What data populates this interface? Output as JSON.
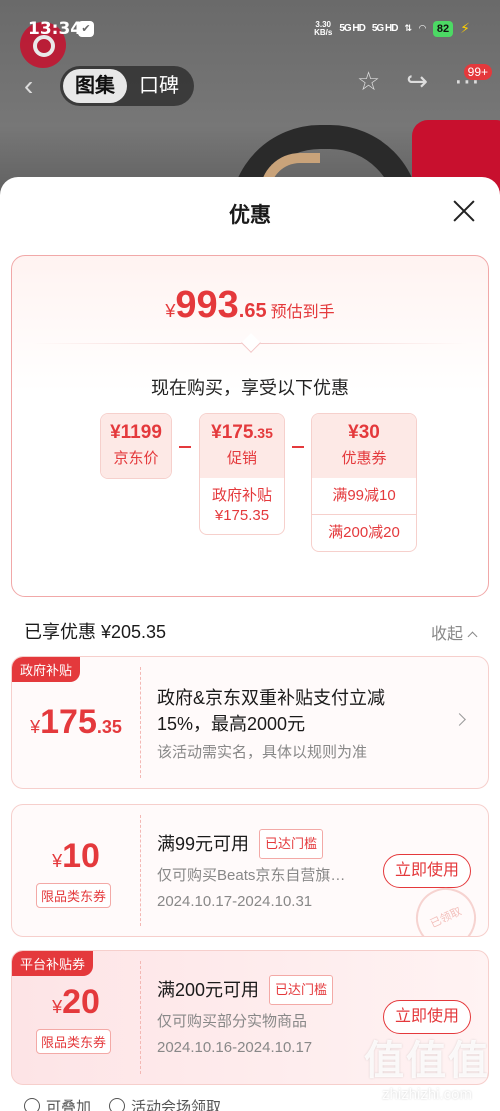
{
  "status_bar": {
    "time": "13:34",
    "net_speed_value": "3.30",
    "net_speed_unit": "KB/s",
    "signal_1": "5G HD",
    "signal_2": "5G HD",
    "battery": "82"
  },
  "nav": {
    "tabs": [
      {
        "label": "图集",
        "active": true
      },
      {
        "label": "口碑",
        "active": false
      }
    ],
    "cart_badge": "99+"
  },
  "sheet": {
    "title": "优惠",
    "summary": {
      "currency": "¥",
      "final_price_int": "993",
      "final_price_dec": ".65",
      "final_price_note": "预估到手",
      "buy_now_text": "现在购买，享受以下优惠",
      "boxes": [
        {
          "value": "¥1199",
          "label": "京东价",
          "subs": []
        },
        {
          "value_main": "¥175",
          "value_small": ".35",
          "label": "促销",
          "subs": [
            "政府补贴\n¥175.35"
          ]
        },
        {
          "value": "¥30",
          "label": "优惠券",
          "subs": [
            "满99减10",
            "满200减20"
          ]
        }
      ]
    },
    "saved": {
      "label": "已享优惠 ¥205.35",
      "collapse": "收起"
    },
    "coupons": [
      {
        "corner_tag": "政府补贴",
        "yen": "¥",
        "amount": "175",
        "amount_dec": ".35",
        "title": "政府&京东双重补贴支付立减15%，最高2000元",
        "desc": "该活动需实名，具体以规则为准"
      },
      {
        "yen": "¥",
        "amount": "10",
        "category": "限品类东券",
        "title": "满99元可用",
        "reached": "已达门槛",
        "desc": "仅可购买Beats京东自营旗…",
        "date": "2024.10.17-2024.10.31",
        "button": "立即使用",
        "stamp": "已领取"
      },
      {
        "corner_tag": "平台补贴券",
        "yen": "¥",
        "amount": "20",
        "category": "限品类东券",
        "title": "满200元可用",
        "reached": "已达门槛",
        "desc": "仅可购买部分实物商品",
        "date": "2024.10.16-2024.10.17",
        "button": "立即使用"
      }
    ],
    "bottom": {
      "stackable": "可叠加",
      "venue": "活动会场领取"
    }
  },
  "watermark": {
    "text": "zhizhizhi.com",
    "logo_glyphs": "值值值"
  },
  "colors": {
    "accent": "#e4393c",
    "tint": "#fde9e6"
  }
}
